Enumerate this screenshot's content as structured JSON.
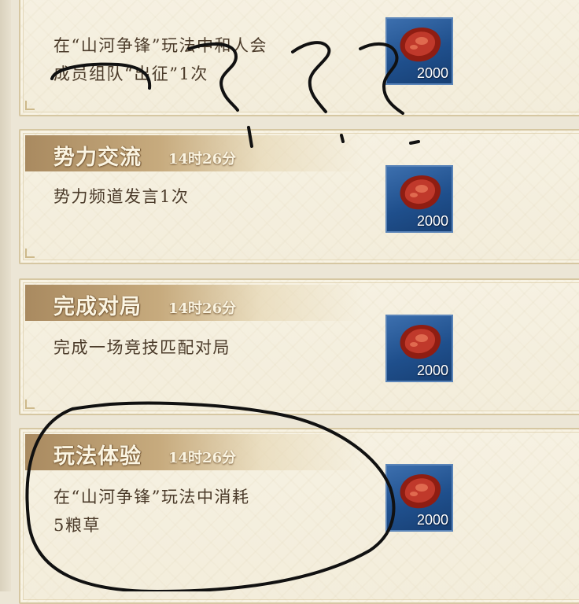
{
  "tasks": [
    {
      "title": "",
      "timer": "",
      "description_lines": [
        "在“山河争锋”玩法中和人会",
        "成员组队“出征”1次"
      ],
      "reward": {
        "icon": "meat-icon",
        "quantity": "2000"
      }
    },
    {
      "title": "势力交流",
      "timer": "14时26分",
      "description_lines": [
        "势力频道发言1次"
      ],
      "reward": {
        "icon": "meat-icon",
        "quantity": "2000"
      }
    },
    {
      "title": "完成对局",
      "timer": "14时26分",
      "description_lines": [
        "完成一场竞技匹配对局"
      ],
      "reward": {
        "icon": "meat-icon",
        "quantity": "2000"
      }
    },
    {
      "title": "玩法体验",
      "timer": "14时26分",
      "description_lines": [
        "在“山河争锋”玩法中消耗",
        "5粮草"
      ],
      "reward": {
        "icon": "meat-icon",
        "quantity": "2000"
      }
    }
  ],
  "colors": {
    "card_background": "#f3eddb",
    "card_border": "#d6c7a2",
    "title_band": "#a98a60",
    "text": "#4b3b2a",
    "reward_tile": "#1f4f8c"
  }
}
